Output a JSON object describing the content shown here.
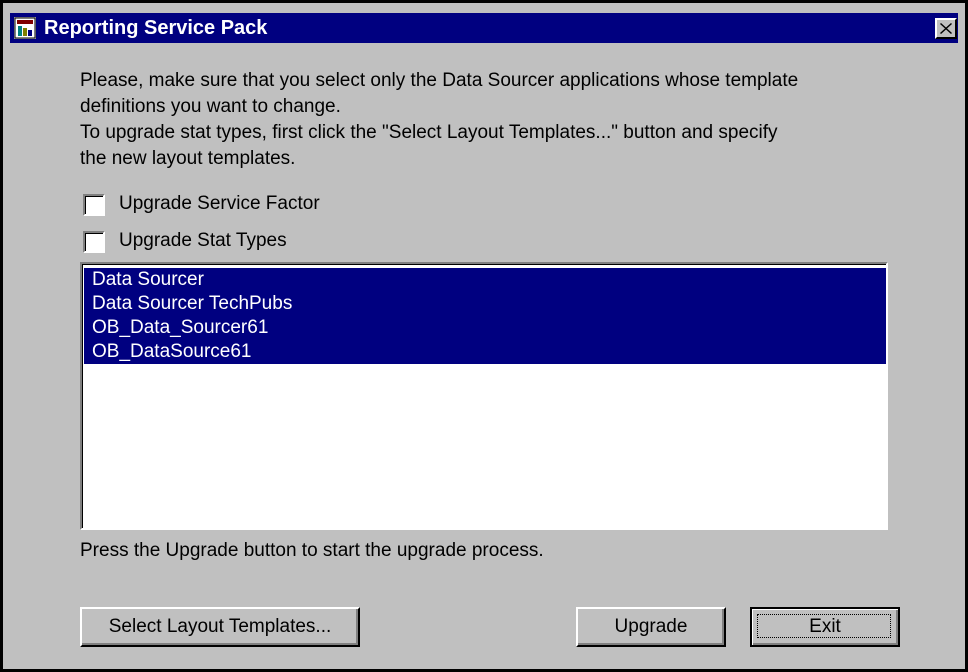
{
  "window": {
    "title": "Reporting Service Pack",
    "icon": "reporting-app-icon",
    "close_icon": "close-icon",
    "title_bar_color": "#000080",
    "face_color": "#c0c0c0"
  },
  "instructions": {
    "line1": "Please, make sure that you select only the Data Sourcer applications whose template",
    "line2": "definitions you want to change.",
    "line3": "To upgrade stat types, first click the \"Select Layout Templates...\" button and specify",
    "line4": "the new layout templates."
  },
  "options": {
    "upgrade_service_factor": {
      "label": "Upgrade Service Factor",
      "checked": false
    },
    "upgrade_stat_types": {
      "label": "Upgrade Stat Types",
      "checked": false
    }
  },
  "applications": {
    "selection_color": "#000080",
    "items": [
      {
        "label": "Data Sourcer",
        "selected": true
      },
      {
        "label": "Data Sourcer TechPubs",
        "selected": true
      },
      {
        "label": "OB_Data_Sourcer61",
        "selected": true
      },
      {
        "label": "OB_DataSource61",
        "selected": true
      }
    ]
  },
  "hint": "Press the Upgrade button to start the upgrade process.",
  "buttons": {
    "select_layout": "Select Layout Templates...",
    "upgrade": "Upgrade",
    "exit": "Exit"
  }
}
